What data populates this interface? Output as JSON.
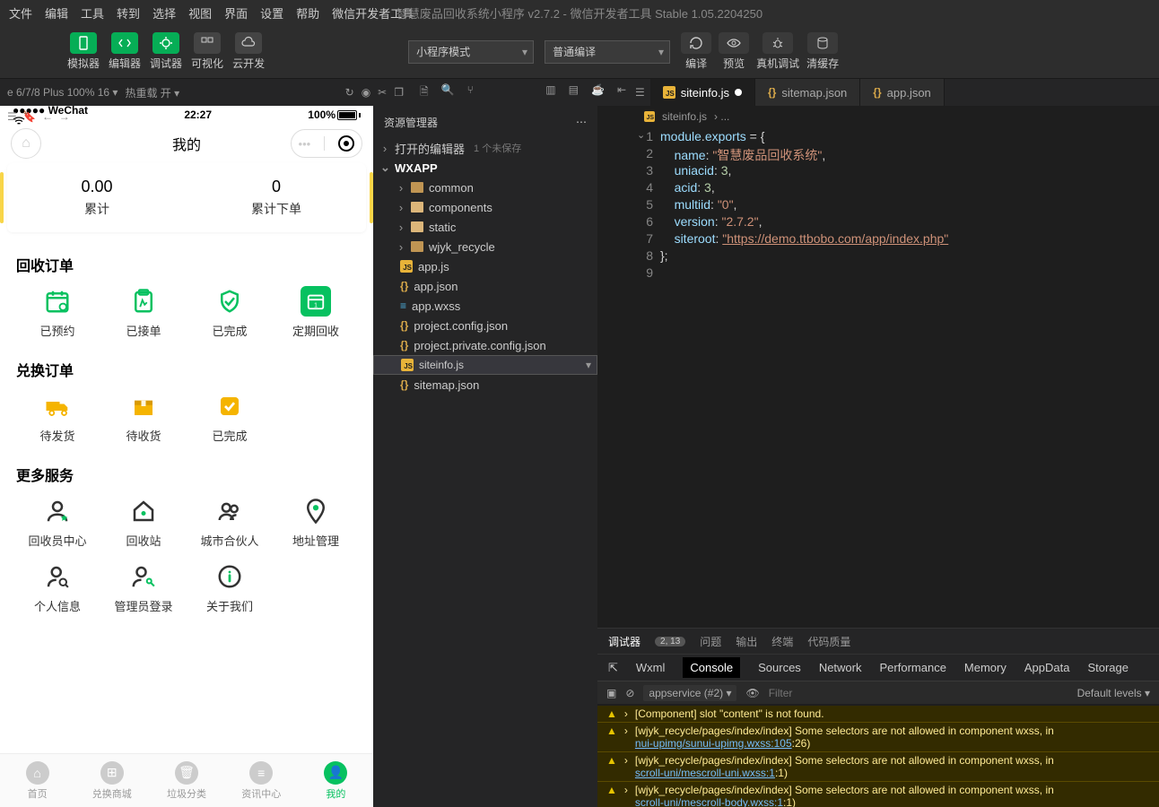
{
  "menubar": {
    "items": [
      "文件",
      "编辑",
      "工具",
      "转到",
      "选择",
      "视图",
      "界面",
      "设置",
      "帮助",
      "微信开发者工具"
    ],
    "title": "智慧废品回收系统小程序 v2.7.2 - 微信开发者工具 Stable 1.05.2204250"
  },
  "toolbar": {
    "left": [
      {
        "label": "模拟器"
      },
      {
        "label": "编辑器"
      },
      {
        "label": "调试器"
      },
      {
        "label": "可视化"
      },
      {
        "label": "云开发"
      }
    ],
    "mode_select": "小程序模式",
    "compile_select": "普通编译",
    "actions": [
      {
        "label": "编译"
      },
      {
        "label": "预览"
      },
      {
        "label": "真机调试"
      },
      {
        "label": "清缓存"
      }
    ]
  },
  "subbar": {
    "device": "e 6/7/8 Plus 100% 16 ▾",
    "hotreload": "热重载 开 ▾"
  },
  "tabs": [
    {
      "id": "siteinfo",
      "label": "siteinfo.js",
      "icon": "js",
      "active": true,
      "dirty": true
    },
    {
      "id": "sitemap",
      "label": "sitemap.json",
      "icon": "json",
      "active": false,
      "dirty": false
    },
    {
      "id": "appjson",
      "label": "app.json",
      "icon": "json",
      "active": false,
      "dirty": false
    }
  ],
  "breadcrumb": {
    "file": "siteinfo.js",
    "chevron": "› ..."
  },
  "explorer": {
    "title": "资源管理器",
    "open_editors": {
      "label": "打开的编辑器",
      "badge": "1 个未保存"
    },
    "root": "WXAPP",
    "folders": [
      "common",
      "components",
      "static",
      "wjyk_recycle"
    ],
    "files": [
      {
        "name": "app.js",
        "icon": "js"
      },
      {
        "name": "app.json",
        "icon": "json"
      },
      {
        "name": "app.wxss",
        "icon": "wxss"
      },
      {
        "name": "project.config.json",
        "icon": "json"
      },
      {
        "name": "project.private.config.json",
        "icon": "json"
      },
      {
        "name": "siteinfo.js",
        "icon": "js",
        "selected": true
      },
      {
        "name": "sitemap.json",
        "icon": "json"
      }
    ]
  },
  "code": {
    "lines": 9,
    "content": {
      "l1_a": "module",
      "l1_b": ".",
      "l1_c": "exports",
      "l1_d": " = {",
      "l2_k": "name",
      "l2_v": "\"智慧废品回收系统\"",
      "l3_k": "uniacid",
      "l3_v": "3",
      "l4_k": "acid",
      "l4_v": "3",
      "l5_k": "multiid",
      "l5_v": "\"0\"",
      "l6_k": "version",
      "l6_v": "\"2.7.2\"",
      "l7_k": "siteroot",
      "l7_v": "\"https://demo.ttbobo.com/app/index.php\"",
      "l8": "};"
    }
  },
  "sim": {
    "carrier": "●●●●● WeChat",
    "wifi": "wifi",
    "time": "22:27",
    "battery": "100%",
    "page_title": "我的",
    "stats": [
      {
        "num": "0.00",
        "label": "累计"
      },
      {
        "num": "0",
        "label": "累计下单"
      }
    ],
    "sections": [
      {
        "title": "回收订单",
        "items": [
          {
            "icon": "calendar",
            "color": "green",
            "label": "已预约"
          },
          {
            "icon": "clipboard",
            "color": "green",
            "label": "已接单"
          },
          {
            "icon": "shield-check",
            "color": "green",
            "label": "已完成"
          },
          {
            "icon": "calendar-fill",
            "color": "green-fill",
            "label": "定期回收"
          }
        ]
      },
      {
        "title": "兑换订单",
        "items": [
          {
            "icon": "truck",
            "color": "yellow",
            "label": "待发货"
          },
          {
            "icon": "box",
            "color": "yellow",
            "label": "待收货"
          },
          {
            "icon": "check-square",
            "color": "yellow",
            "label": "已完成"
          }
        ]
      },
      {
        "title": "更多服务",
        "items": [
          {
            "icon": "user-star",
            "color": "dark",
            "label": "回收员中心"
          },
          {
            "icon": "home-pin",
            "color": "dark",
            "label": "回收站"
          },
          {
            "icon": "users",
            "color": "dark",
            "label": "城市合伙人"
          },
          {
            "icon": "pin",
            "color": "dark",
            "label": "地址管理"
          },
          {
            "icon": "user-search",
            "color": "dark",
            "label": "个人信息"
          },
          {
            "icon": "user-key",
            "color": "dark",
            "label": "管理员登录"
          },
          {
            "icon": "info",
            "color": "dark",
            "label": "关于我们"
          }
        ]
      }
    ],
    "tabbar": [
      {
        "label": "首页",
        "active": false
      },
      {
        "label": "兑换商城",
        "active": false
      },
      {
        "label": "垃圾分类",
        "active": false
      },
      {
        "label": "资讯中心",
        "active": false
      },
      {
        "label": "我的",
        "active": true
      }
    ]
  },
  "debugger": {
    "tabs": [
      "调试器",
      "问题",
      "输出",
      "终端",
      "代码质量"
    ],
    "count": "2, 13",
    "devtools": [
      "Wxml",
      "Console",
      "Sources",
      "Network",
      "Performance",
      "Memory",
      "AppData",
      "Storage"
    ],
    "devtools_active": "Console",
    "context": "appservice (#2)",
    "filter_placeholder": "Filter",
    "levels": "Default levels ▾",
    "warnings": [
      {
        "pre": "[Component] slot \"content\" is not found.",
        "link": "",
        "tail": ""
      },
      {
        "pre": "[wjyk_recycle/pages/index/index] Some selectors are not allowed in component wxss, in",
        "link": "nui-upimg/sunui-upimg.wxss:105",
        "tail": ":26)"
      },
      {
        "pre": "[wjyk_recycle/pages/index/index] Some selectors are not allowed in component wxss, in",
        "link": "scroll-uni/mescroll-uni.wxss:1",
        "tail": ":1)"
      },
      {
        "pre": "[wjyk_recycle/pages/index/index] Some selectors are not allowed in component wxss, in",
        "link": "scroll-uni/mescroll-body.wxss:1",
        "tail": ":1)"
      }
    ]
  }
}
